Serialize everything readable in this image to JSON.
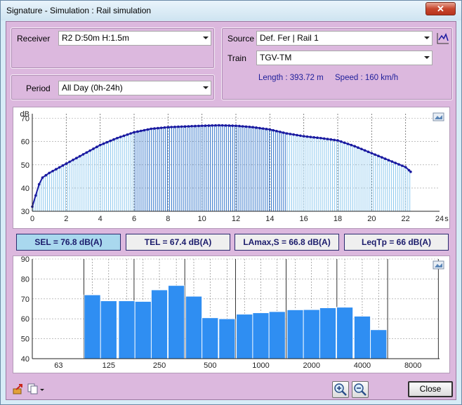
{
  "window": {
    "title": "Signature - Simulation : Rail simulation",
    "close_glyph": "✕"
  },
  "receiver": {
    "label": "Receiver",
    "value": "R2 D:50m H:1.5m"
  },
  "period": {
    "label": "Period",
    "value": "All Day (0h-24h)"
  },
  "source": {
    "label": "Source",
    "value": "Def. Fer | Rail 1"
  },
  "train": {
    "label": "Train",
    "value": "TGV-TM",
    "length": "Length : 393.72 m",
    "speed": "Speed : 160 km/h"
  },
  "metrics": [
    {
      "label": "SEL = 76.8 dB(A)",
      "active": true
    },
    {
      "label": "TEL = 67.4 dB(A)",
      "active": false
    },
    {
      "label": "LAmax,S = 66.8 dB(A)",
      "active": false
    },
    {
      "label": "LeqTp = 66 dB(A)",
      "active": false
    }
  ],
  "footer": {
    "close_label": "Close"
  },
  "colors": {
    "time_line": "#1a1aa0",
    "time_fill_light": "#8ec9ee",
    "time_fill_dark": "#2f73c9",
    "spectrum_bar": "#2f8ef2"
  },
  "chart_data": [
    {
      "type": "line",
      "ylabel": "dB",
      "xlabel_unit": "s",
      "xlim": [
        0,
        24
      ],
      "ylim": [
        30,
        72
      ],
      "x_ticks": [
        0,
        2,
        4,
        6,
        8,
        10,
        12,
        14,
        16,
        18,
        20,
        22,
        24
      ],
      "y_ticks": [
        30,
        40,
        50,
        60,
        70
      ],
      "x_tick_labels": [
        "0",
        "2",
        "4",
        "6",
        "8",
        "10",
        "12",
        "14",
        "16",
        "18",
        "20",
        "22",
        "24"
      ],
      "y_tick_labels": [
        "dB",
        "70",
        "60",
        "50",
        "40",
        "30"
      ],
      "highlight_range": [
        6,
        15
      ],
      "x": [
        0,
        0.5,
        1,
        2,
        3,
        4,
        5,
        6,
        7,
        8,
        9,
        10,
        11,
        12,
        13,
        14,
        15,
        16,
        17,
        18,
        19,
        20,
        21,
        22,
        22.3
      ],
      "y": [
        32,
        44,
        46.5,
        50.5,
        54.5,
        58.5,
        61.5,
        64,
        65.5,
        66.2,
        66.5,
        66.8,
        67,
        66.8,
        66.2,
        65.2,
        63.5,
        62.3,
        61.5,
        60.5,
        58,
        55,
        52,
        49,
        47
      ]
    },
    {
      "type": "bar",
      "xscale": "log",
      "ylim": [
        40,
        90
      ],
      "y_ticks": [
        40,
        50,
        60,
        70,
        80,
        90
      ],
      "x_tick_labels": [
        "63",
        "125",
        "250",
        "500",
        "1000",
        "2000",
        "4000",
        "8000"
      ],
      "x_ticks": [
        63,
        125,
        250,
        500,
        1000,
        2000,
        4000,
        8000
      ],
      "categories": [
        "100",
        "125",
        "160",
        "200",
        "250",
        "315",
        "400",
        "500",
        "630",
        "800",
        "1000",
        "1250",
        "1600",
        "2000",
        "2500",
        "3150",
        "4000",
        "5000"
      ],
      "values": [
        72,
        69,
        69,
        68.7,
        74.5,
        76.7,
        71.3,
        60.5,
        60,
        62.3,
        63,
        63.6,
        64.5,
        64.6,
        65.5,
        65.8,
        61.3,
        54.5
      ]
    }
  ]
}
